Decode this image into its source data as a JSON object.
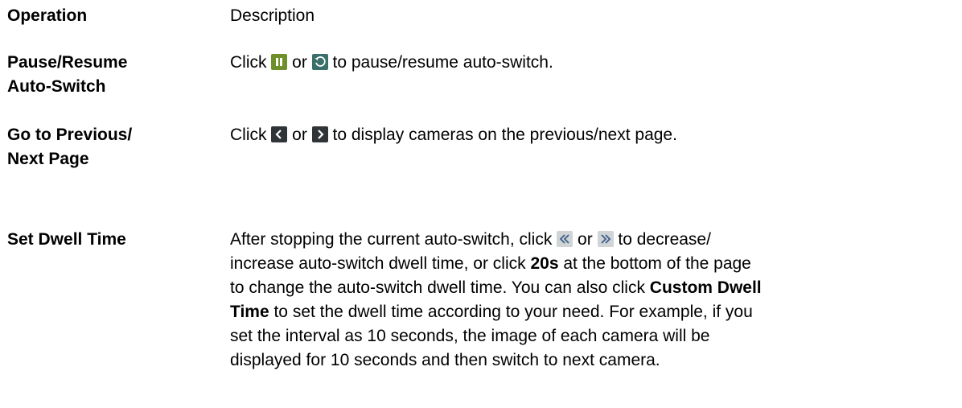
{
  "header": {
    "operation": "Operation",
    "description": "Description"
  },
  "rows": [
    {
      "operation_line1": "Pause/Resume",
      "operation_line2": "Auto-Switch",
      "desc_pre": "Click ",
      "desc_mid": " or ",
      "desc_post": " to pause/resume auto-switch.",
      "icons": [
        "pause-icon",
        "resume-icon"
      ]
    },
    {
      "operation_line1": "Go to Previous/",
      "operation_line2": "Next Page",
      "desc_pre": "Click ",
      "desc_mid": " or ",
      "desc_post": " to display cameras on the previous/next page.",
      "icons": [
        "chevron-left-icon",
        "chevron-right-icon"
      ]
    },
    {
      "operation": "Set Dwell Time",
      "desc_pre": "After stopping the current auto-switch, click ",
      "desc_mid": " or ",
      "desc_post1": " to decrease/",
      "desc_line2": "increase auto-switch dwell time, or click ",
      "desc_bold1": "20s",
      "desc_line2_post": " at the bottom of the page",
      "desc_line3": "to change the auto-switch dwell time. You can also click ",
      "desc_bold2a": "Custom Dwell",
      "desc_bold2b": "Time",
      "desc_line4_post": " to set the dwell time according to your need. For example, if you",
      "desc_line5": "set the interval as 10 seconds, the image of each camera will be",
      "desc_line6": "displayed for 10 seconds and then switch to next camera.",
      "icons": [
        "double-chevron-left-icon",
        "double-chevron-right-icon"
      ]
    }
  ],
  "colors": {
    "pause_icon_bg": "#6f8f2a",
    "resume_icon_bg": "#3a6f6a",
    "nav_icon_bg": "#2f3436",
    "dwell_icon_bg": "#d0d4d6"
  }
}
